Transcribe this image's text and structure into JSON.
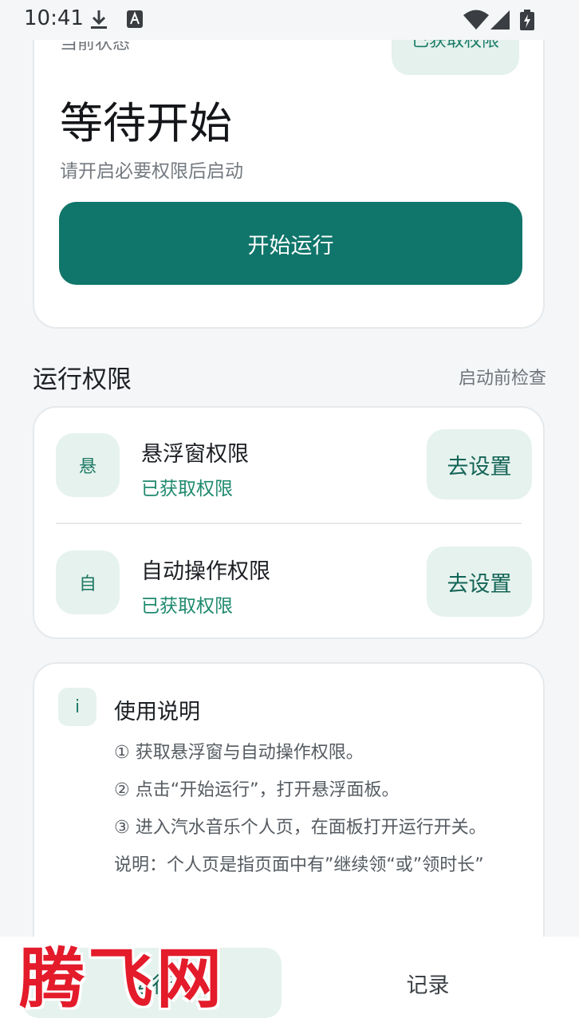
{
  "statusbar": {
    "time": "10:41"
  },
  "status_card": {
    "label": "当前状态",
    "badge": "已获取权限",
    "title": "等待开始",
    "subtitle": "请开启必要权限后启动",
    "start_button": "开始运行"
  },
  "permissions": {
    "title": "运行权限",
    "hint": "启动前检查",
    "items": [
      {
        "avatar": "悬",
        "name": "悬浮窗权限",
        "state": "已获取权限",
        "button": "去设置"
      },
      {
        "avatar": "自",
        "name": "自动操作权限",
        "state": "已获取权限",
        "button": "去设置"
      }
    ]
  },
  "help": {
    "icon": "i",
    "title": "使用说明",
    "lines": [
      "① 获取悬浮窗与自动操作权限。",
      "② 点击“开始运行”，打开悬浮面板。",
      "③ 进入汽水音乐个人页，在面板打开运行开关。",
      "说明：个人页是指页面中有”继续领“或”领时长”"
    ]
  },
  "nav": {
    "run": "运行",
    "log": "记录"
  },
  "watermark": "腾飞网",
  "colors": {
    "primary": "#10756a",
    "accent_bg": "#e6f2ed",
    "success": "#1f8a6e",
    "watermark": "#e31b2a"
  }
}
